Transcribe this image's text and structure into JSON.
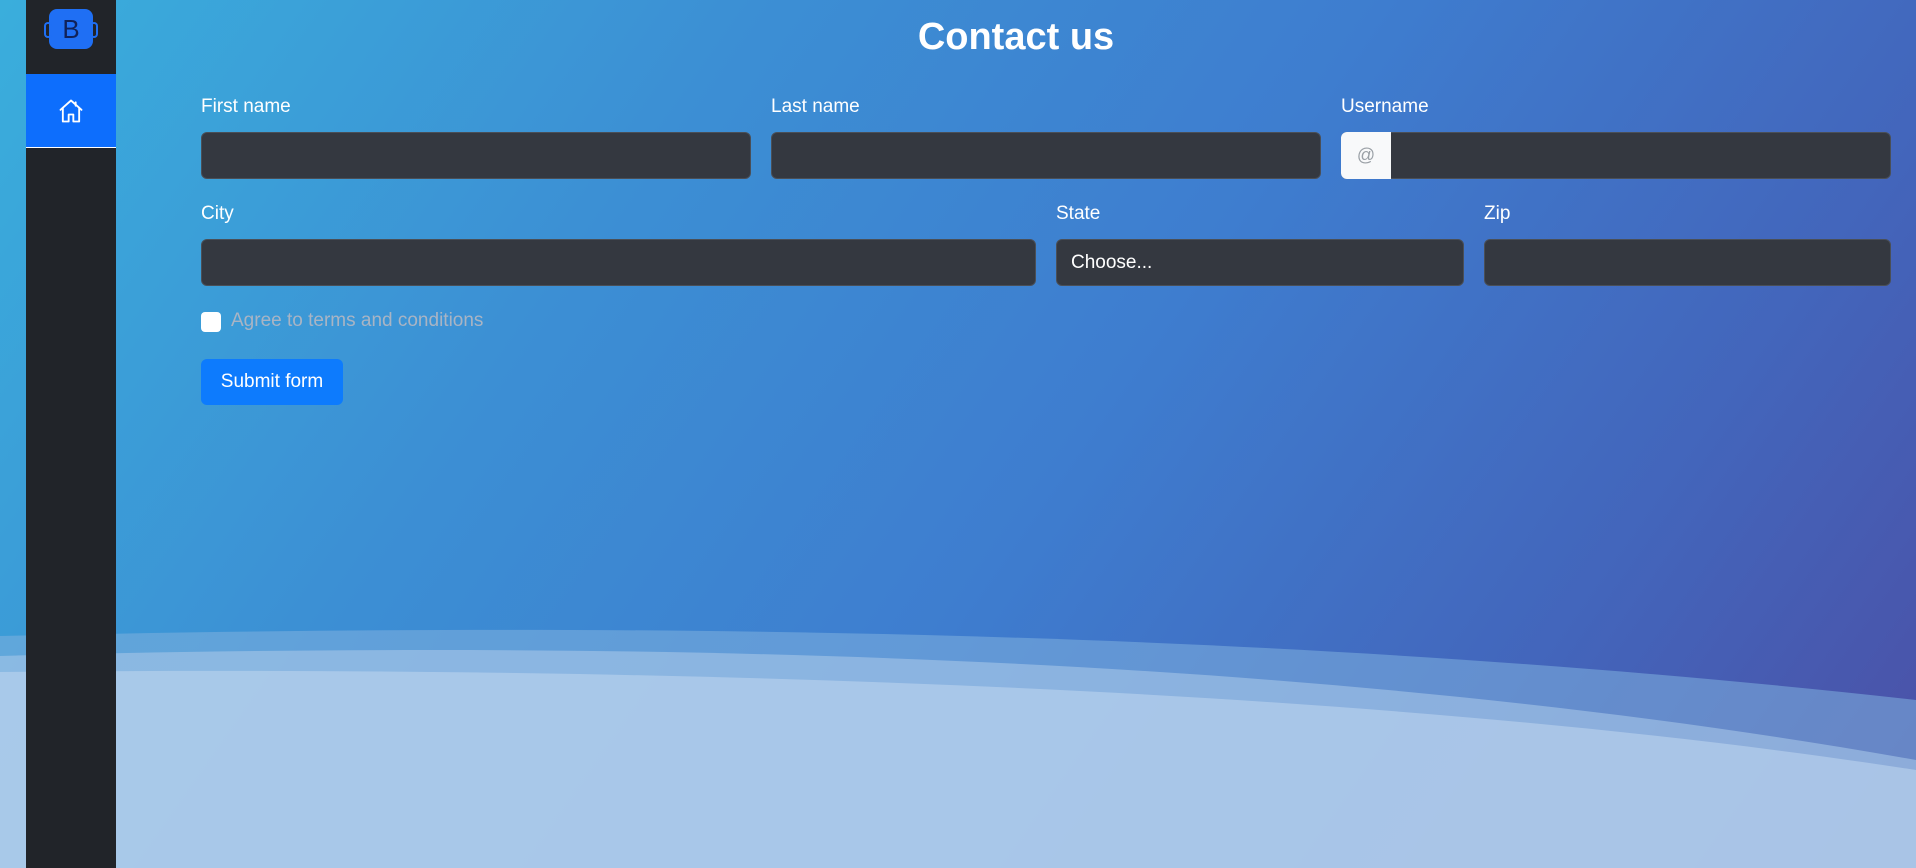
{
  "page": {
    "title": "Contact us"
  },
  "sidebar": {
    "brand_letter": "B"
  },
  "form": {
    "first_name_label": "First name",
    "last_name_label": "Last name",
    "username_label": "Username",
    "username_prefix": "@",
    "city_label": "City",
    "state_label": "State",
    "state_selected": "Choose...",
    "zip_label": "Zip",
    "terms_label": "Agree to terms and conditions",
    "submit_label": "Submit form"
  },
  "colors": {
    "accent": "#0d6efd",
    "sidebar_bg": "#212429",
    "input_bg": "#343840"
  }
}
